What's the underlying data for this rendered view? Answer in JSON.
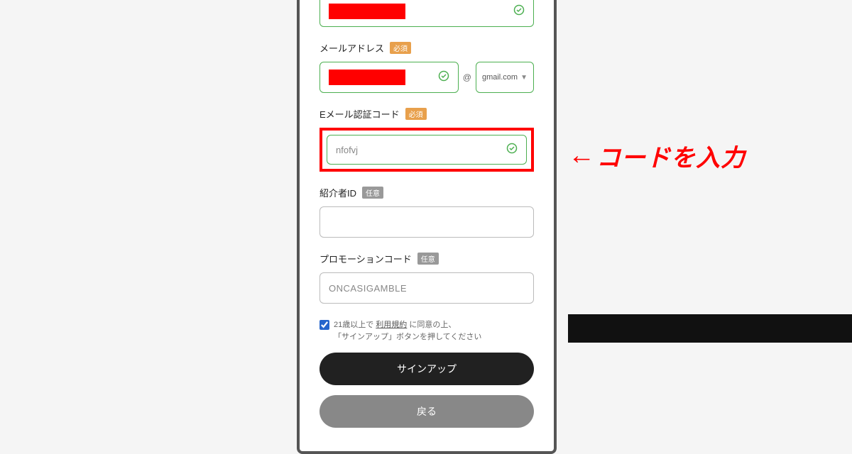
{
  "fields": {
    "email": {
      "label": "メールアドレス",
      "badge": "必須",
      "at": "@",
      "domain": "gmail.com"
    },
    "code": {
      "label": "Eメール認証コード",
      "badge": "必須",
      "value": "nfofvj"
    },
    "referrer": {
      "label": "紹介者ID",
      "badge": "任意"
    },
    "promo": {
      "label": "プロモーションコード",
      "badge": "任意",
      "value": "ONCASIGAMBLE"
    }
  },
  "agreement": {
    "text1": "21歳以上で ",
    "link": "利用規約",
    "text2": " に同意の上、",
    "text3": "「サインアップ」ボタンを押してください"
  },
  "buttons": {
    "signup": "サインアップ",
    "back": "戻る"
  },
  "annotation": {
    "arrow": "←",
    "text": "コードを入力"
  }
}
